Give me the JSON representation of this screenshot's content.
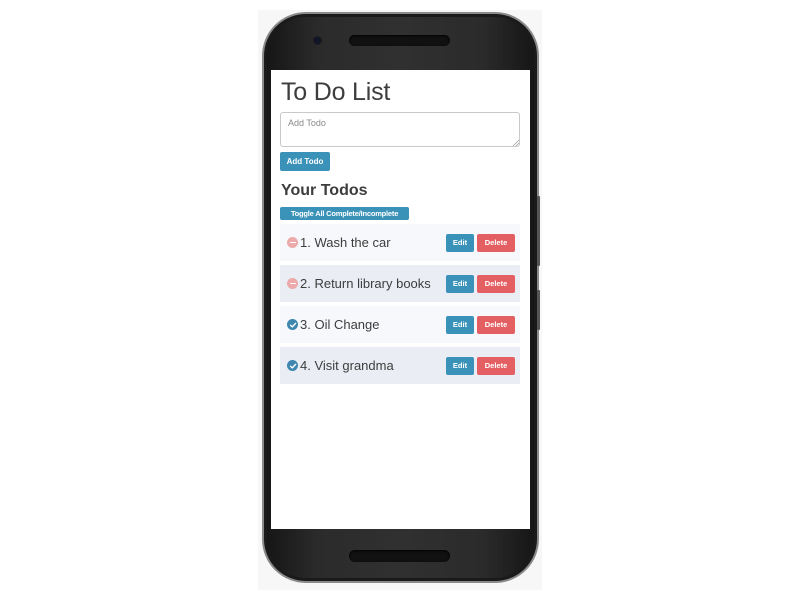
{
  "app": {
    "title": "To Do List",
    "input_placeholder": "Add Todo",
    "add_button_label": "Add Todo",
    "list_heading": "Your Todos",
    "toggle_all_label": "Toggle All Complete/Incomplete"
  },
  "todos": [
    {
      "text": "1. Wash the car",
      "status": "incomplete",
      "edit_label": "Edit",
      "delete_label": "Delete"
    },
    {
      "text": "2. Return library books",
      "status": "incomplete",
      "edit_label": "Edit",
      "delete_label": "Delete"
    },
    {
      "text": "3. Oil Change",
      "status": "complete",
      "edit_label": "Edit",
      "delete_label": "Delete"
    },
    {
      "text": "4. Visit grandma",
      "status": "complete",
      "edit_label": "Edit",
      "delete_label": "Delete"
    }
  ],
  "colors": {
    "primary": "#3b92b8",
    "danger": "#e35f62",
    "incomplete_icon": "#ecaaaa",
    "complete_icon": "#3f86b0",
    "row_light": "#f6f8fb",
    "row_dark": "#eaeef4"
  },
  "icons": {
    "incomplete": "minus-circle-icon",
    "complete": "check-circle-icon"
  }
}
